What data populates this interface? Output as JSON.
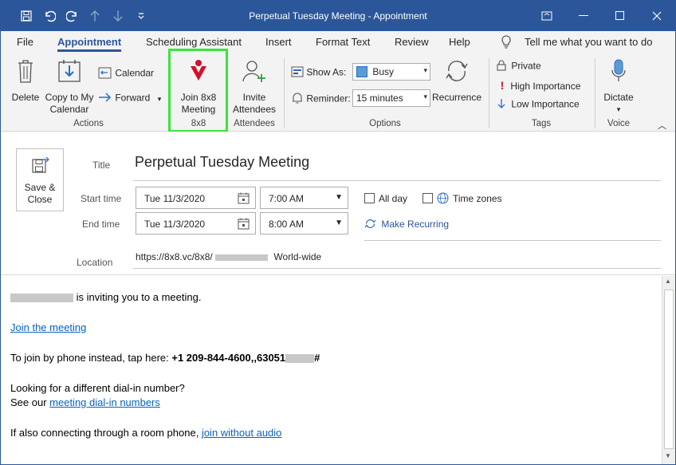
{
  "window": {
    "title": "Perpetual Tuesday Meeting  -  Appointment"
  },
  "tabs": [
    "File",
    "Appointment",
    "Scheduling Assistant",
    "Insert",
    "Format Text",
    "Review",
    "Help"
  ],
  "tell_me": "Tell me what you want to do",
  "ribbon": {
    "actions": {
      "delete": "Delete",
      "copy_to_calendar_line1": "Copy to My",
      "copy_to_calendar_line2": "Calendar",
      "calendar": "Calendar",
      "forward": "Forward",
      "group_label": "Actions"
    },
    "eightxeight": {
      "join_line1": "Join 8x8",
      "join_line2": "Meeting",
      "group_label": "8x8"
    },
    "attendees": {
      "invite_line1": "Invite",
      "invite_line2": "Attendees",
      "group_label": "Attendees"
    },
    "options": {
      "show_as_label": "Show As:",
      "show_as_value": "Busy",
      "reminder_label": "Reminder:",
      "reminder_value": "15 minutes",
      "recurrence": "Recurrence",
      "group_label": "Options"
    },
    "tags": {
      "private": "Private",
      "high": "High Importance",
      "low": "Low Importance",
      "group_label": "Tags"
    },
    "voice": {
      "dictate": "Dictate",
      "group_label": "Voice"
    }
  },
  "form": {
    "save_close_line1": "Save &",
    "save_close_line2": "Close",
    "title_label": "Title",
    "title_value": "Perpetual Tuesday Meeting",
    "start_label": "Start time",
    "start_date": "Tue 11/3/2020",
    "start_time": "7:00 AM",
    "end_label": "End time",
    "end_date": "Tue 11/3/2020",
    "end_time": "8:00 AM",
    "all_day": "All day",
    "time_zones": "Time zones",
    "make_recurring": "Make Recurring",
    "location_label": "Location",
    "location_prefix": "https://8x8.vc/8x8/",
    "location_suffix": "World-wide"
  },
  "body": {
    "invite_text": "is inviting you to a meeting.",
    "join_link": "Join the meeting",
    "phone_prefix": "To join by phone instead, tap here: ",
    "phone_number": "+1 209-844-4600,,63051",
    "phone_suffix": "#",
    "dialin_q": "Looking for a different dial-in number?",
    "see_our": "See our ",
    "dialin_link": "meeting dial-in numbers",
    "room_prefix": "If also connecting through a room phone, ",
    "room_link": "join without audio"
  },
  "colors": {
    "titlebar": "#2b579a",
    "accent": "#2b579a",
    "highlight": "#3ce43c",
    "eightxeight": "#d0112b",
    "link": "#0563c1"
  }
}
